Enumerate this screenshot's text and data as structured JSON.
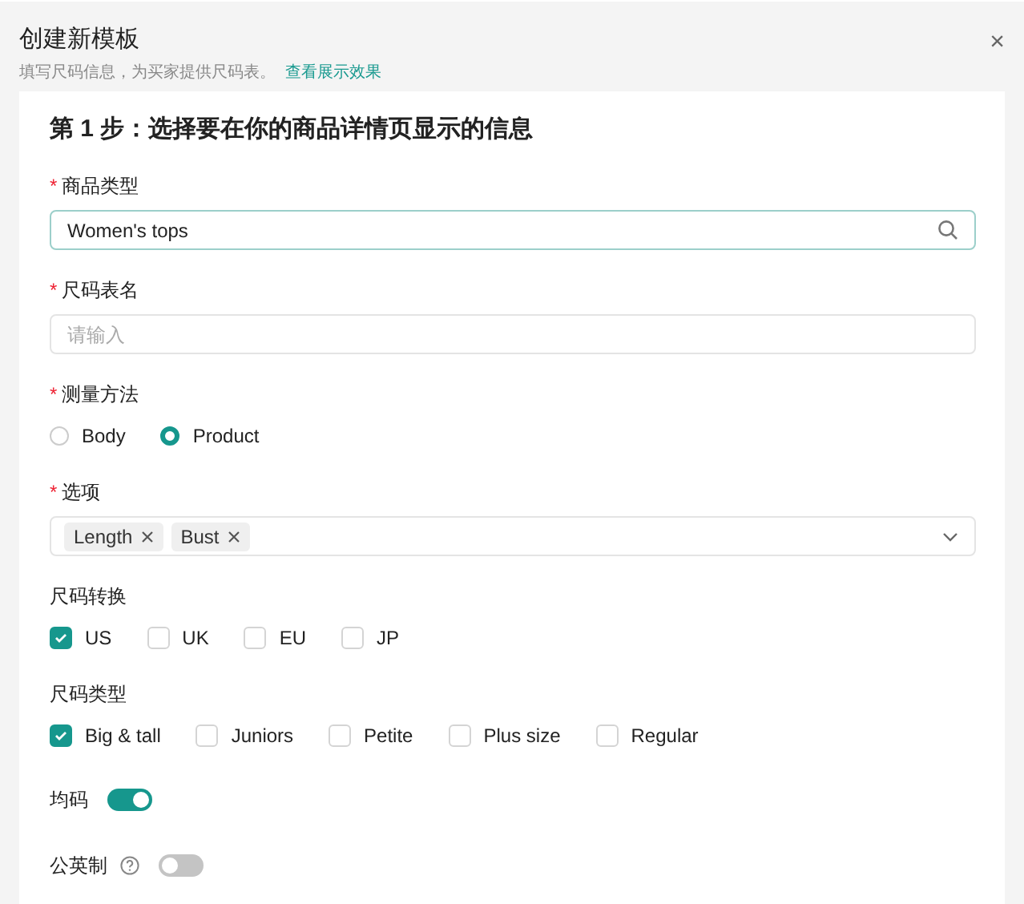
{
  "dialog": {
    "title": "创建新模板",
    "subtitle": "填写尺码信息，为买家提供尺码表。",
    "link": "查看展示效果",
    "close": "×"
  },
  "step_title": "第 1 步：选择要在你的商品详情页显示的信息",
  "fields": [
    {
      "kind": "search",
      "label": "商品类型",
      "required_mark": "*",
      "value": "Women's tops"
    },
    {
      "kind": "text",
      "label": "尺码表名",
      "required_mark": "*",
      "placeholder": "请输入"
    },
    {
      "kind": "radio",
      "label": "测量方法",
      "required_mark": "*",
      "options": [
        {
          "label": "Body",
          "selected": false
        },
        {
          "label": "Product",
          "selected": true
        }
      ]
    },
    {
      "kind": "tags",
      "label": "选项",
      "required_mark": "*",
      "tags": [
        "Length",
        "Bust"
      ]
    },
    {
      "kind": "checkbox",
      "label": "尺码转换",
      "options": [
        {
          "label": "US",
          "checked": true
        },
        {
          "label": "UK",
          "checked": false
        },
        {
          "label": "EU",
          "checked": false
        },
        {
          "label": "JP",
          "checked": false
        }
      ]
    },
    {
      "kind": "checkbox",
      "label": "尺码类型",
      "options": [
        {
          "label": "Big & tall",
          "checked": true
        },
        {
          "label": "Juniors",
          "checked": false
        },
        {
          "label": "Petite",
          "checked": false
        },
        {
          "label": "Plus size",
          "checked": false
        },
        {
          "label": "Regular",
          "checked": false
        }
      ]
    },
    {
      "kind": "switch",
      "label": "均码",
      "help": false,
      "on": true
    },
    {
      "kind": "switch",
      "label": "公英制",
      "help": true,
      "on": false
    }
  ]
}
